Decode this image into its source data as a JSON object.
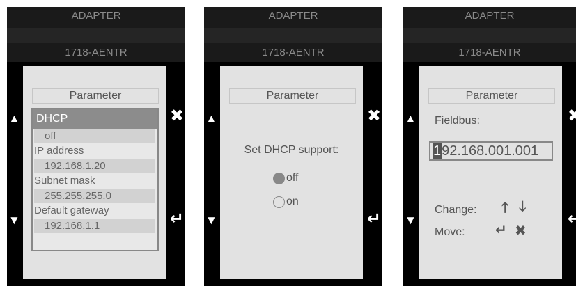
{
  "common": {
    "header_title": "ADAPTER",
    "device": "1718-AENTR",
    "section_title": "Parameter",
    "nav": {
      "up": "▲",
      "down": "▼",
      "cancel": "✖",
      "enter": "↵"
    }
  },
  "panel1": {
    "selected_item": "DHCP",
    "items": [
      {
        "label": "DHCP",
        "value": "off"
      },
      {
        "label": "IP address",
        "value": "192.168.1.20"
      },
      {
        "label": "Subnet mask",
        "value": "255.255.255.0"
      },
      {
        "label": "Default gateway",
        "value": "192.168.1.1"
      }
    ]
  },
  "panel2": {
    "prompt": "Set DHCP support:",
    "options": [
      {
        "label": "off",
        "selected": true
      },
      {
        "label": "on",
        "selected": false
      }
    ]
  },
  "panel3": {
    "field_label": "Fieldbus:",
    "ip_cursor_char": "1",
    "ip_rest": "92.168.001.001",
    "help_change": "Change:",
    "help_move": "Move:",
    "icons": {
      "change_up": "🡑",
      "change_down": "🡓",
      "move_enter": "↵",
      "move_cancel": "✖"
    }
  }
}
